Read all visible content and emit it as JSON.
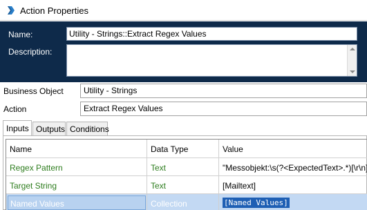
{
  "window": {
    "title": "Action Properties",
    "icon": "action-properties-icon"
  },
  "header": {
    "name_label": "Name:",
    "name_value": "Utility - Strings::Extract Regex Values",
    "description_label": "Description:",
    "description_value": ""
  },
  "fields": {
    "business_object_label": "Business Object",
    "business_object_value": "Utility - Strings",
    "action_label": "Action",
    "action_value": "Extract Regex Values"
  },
  "tabs": [
    {
      "label": "Inputs",
      "active": true
    },
    {
      "label": "Outputs",
      "active": false
    },
    {
      "label": "Conditions",
      "active": false
    }
  ],
  "grid": {
    "columns": [
      "Name",
      "Data Type",
      "Value"
    ],
    "rows": [
      {
        "name": "Regex Pattern",
        "type": "Text",
        "value": "\"Messobjekt:\\s(?<ExpectedText>.*)[\\r\\n]+\""
      },
      {
        "name": "Target String",
        "type": "Text",
        "value": "[Mailtext]"
      },
      {
        "name": "Named Values",
        "type": "Collection",
        "value": "[Named Values]"
      }
    ]
  },
  "colors": {
    "header_bg": "#0e2a4a",
    "param_text": "#2e7d1e",
    "selected_row": "#c3d9f3",
    "selected_value_bg": "#1e5fb4"
  }
}
